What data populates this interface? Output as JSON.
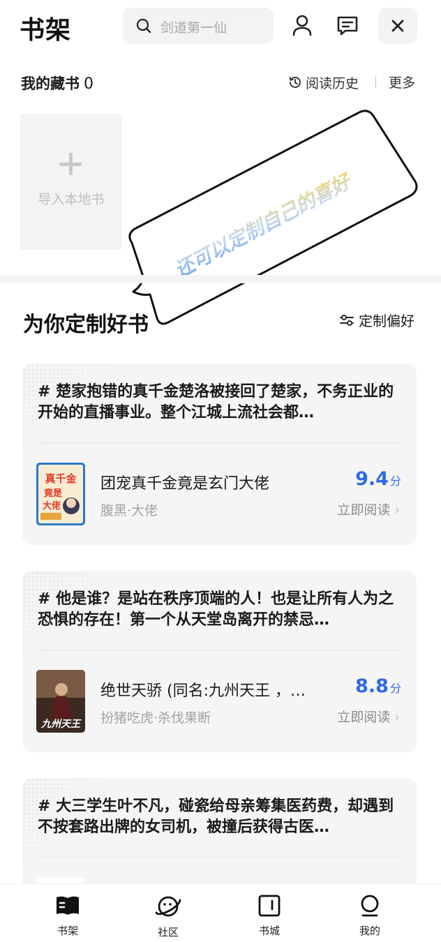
{
  "header": {
    "title": "书架",
    "search_placeholder": "剑道第一仙",
    "icons": [
      "search-icon",
      "user-icon",
      "message-icon",
      "close-icon"
    ]
  },
  "shelf": {
    "title": "我的藏书",
    "count": "0",
    "history_label": "阅读历史",
    "more_label": "更多",
    "import_label": "导入本地书"
  },
  "bubble": {
    "text": "还可以定制自己的喜好"
  },
  "recommend": {
    "title": "为你定制好书",
    "pref_label": "定制偏好",
    "cards": [
      {
        "desc": "# 楚家抱错的真千金楚洛被接回了楚家，不务正业的开始的直播事业。整个江城上流社会都…",
        "book_name": "团宠真千金竟是玄门大佬",
        "tags": "腹黑·大佬",
        "score": "9.4",
        "unit": "分",
        "read_label": "立即阅读",
        "cover_text": "真千金竟是大佬"
      },
      {
        "desc": "# 他是谁？是站在秩序顶端的人！也是让所有人为之恐惧的存在！第一个从天堂岛离开的禁忌…",
        "book_name": "绝世天骄 (同名:九州天王 ，…",
        "tags": "扮猪吃虎·杀伐果断",
        "score": "8.8",
        "unit": "分",
        "read_label": "立即阅读",
        "cover_text": "九州天王"
      },
      {
        "desc": "# 大三学生叶不凡，碰瓷给母亲筹集医药费，却遇到不按套路出牌的女司机，被撞后获得古医…",
        "book_name": "",
        "tags": "",
        "score": "",
        "unit": "",
        "read_label": "",
        "cover_text": ""
      }
    ]
  },
  "tabbar": {
    "items": [
      {
        "label": "书架",
        "icon": "bookshelf-icon",
        "active": true
      },
      {
        "label": "社区",
        "icon": "planet-icon",
        "active": false
      },
      {
        "label": "书城",
        "icon": "bookstore-icon",
        "active": false
      },
      {
        "label": "我的",
        "icon": "profile-icon",
        "active": false
      }
    ]
  },
  "colors": {
    "accent": "#2f6be0",
    "card_bg": "#f5f5f5",
    "search_bg": "#f3f3f3"
  }
}
